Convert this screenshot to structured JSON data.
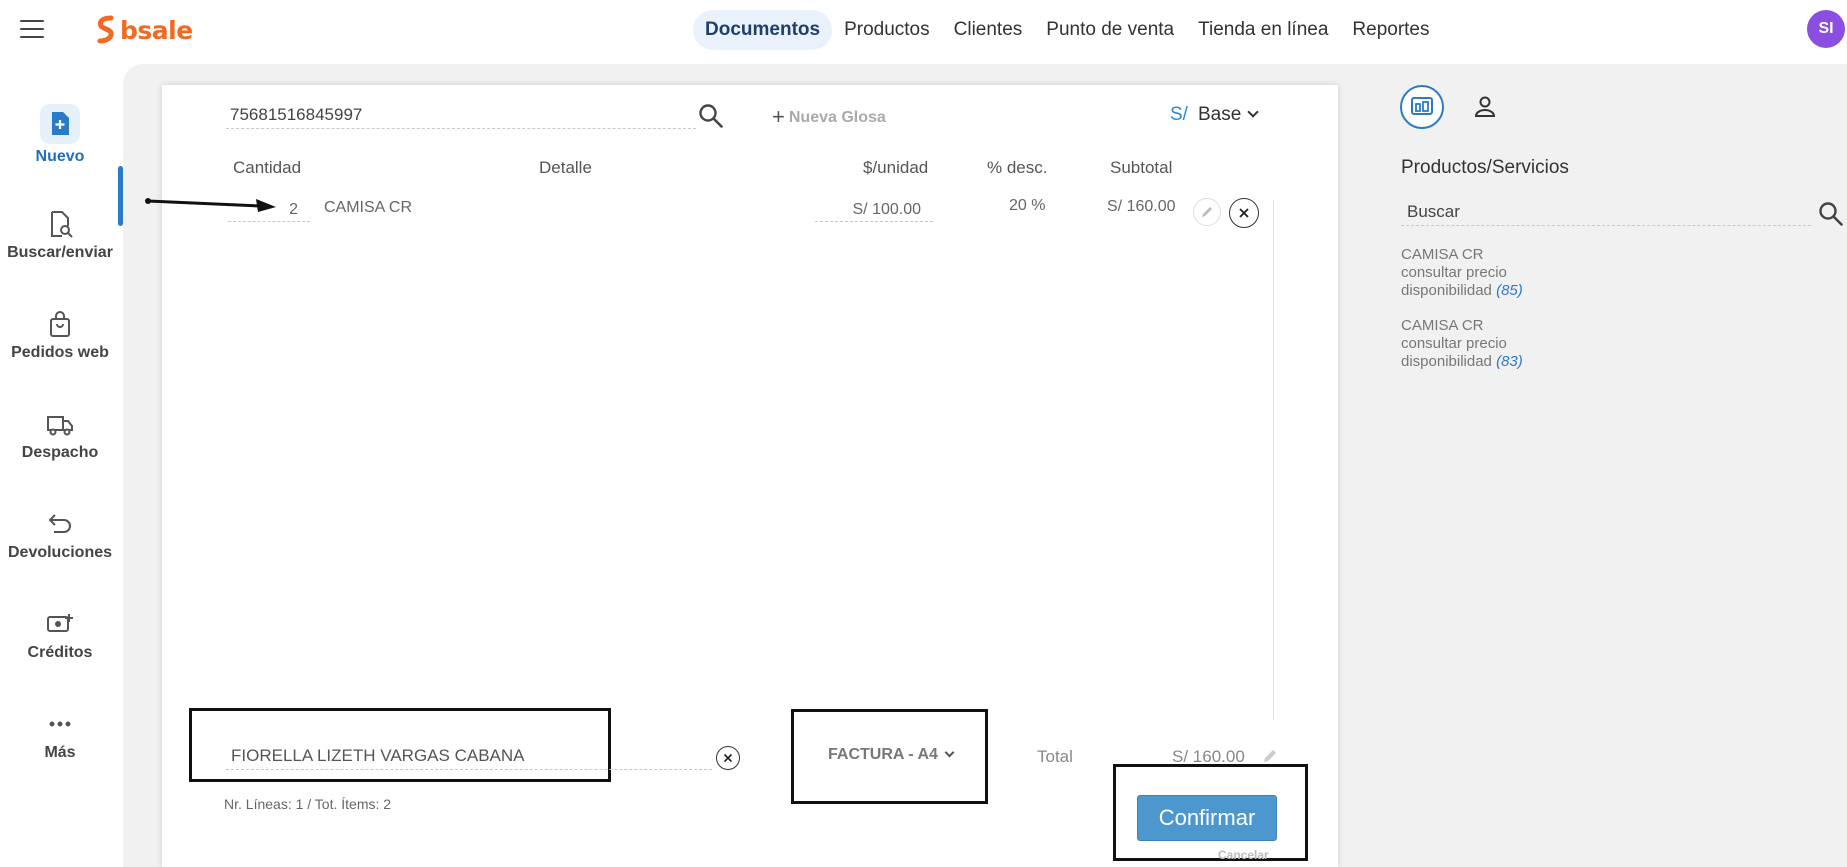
{
  "header": {
    "logo_text": "bsale",
    "nav": [
      {
        "label": "Documentos",
        "active": true
      },
      {
        "label": "Productos"
      },
      {
        "label": "Clientes"
      },
      {
        "label": "Punto de venta"
      },
      {
        "label": "Tienda en línea"
      },
      {
        "label": "Reportes"
      }
    ],
    "avatar_initials": "SI"
  },
  "sidebar": {
    "items": [
      {
        "label": "Nuevo",
        "icon": "document-plus-icon",
        "active": true
      },
      {
        "label": "Buscar/enviar",
        "icon": "document-search-icon"
      },
      {
        "label": "Pedidos web",
        "icon": "shopping-bag-icon"
      },
      {
        "label": "Despacho",
        "icon": "truck-icon"
      },
      {
        "label": "Devoluciones",
        "icon": "return-arrow-icon"
      },
      {
        "label": "Créditos",
        "icon": "money-plus-icon"
      },
      {
        "label": "Más",
        "icon": "more-dots-icon"
      }
    ]
  },
  "document": {
    "search_value": "75681516845997",
    "nueva_glosa": "Nueva Glosa",
    "currency_symbol": "S/",
    "price_list": "Base",
    "columns": {
      "qty": "Cantidad",
      "detail": "Detalle",
      "unit_price": "$/unidad",
      "discount": "% desc.",
      "subtotal": "Subtotal"
    },
    "rows": [
      {
        "qty": "2",
        "detail": "CAMISA CR",
        "unit_price": "S/ 100.00",
        "discount": "20 %",
        "subtotal": "S/ 160.00"
      }
    ],
    "client_name": "FIORELLA LIZETH VARGAS CABANA",
    "document_type": "FACTURA - A4",
    "total_label": "Total",
    "total_value": "S/ 160.00",
    "stats": "Nr. Líneas: 1 / Tot. Ítems: 2",
    "confirm_label": "Confirmar",
    "cancel_label": "Cancelar"
  },
  "right_panel": {
    "title": "Productos/Servicios",
    "search_placeholder": "Buscar",
    "products": [
      {
        "name": "CAMISA CR",
        "price": "consultar precio",
        "availability_label": "disponibilidad",
        "stock": "(85)"
      },
      {
        "name": "CAMISA CR",
        "price": "consultar precio",
        "availability_label": "disponibilidad",
        "stock": "(83)"
      }
    ]
  },
  "colors": {
    "brand": "#f26a21",
    "accent": "#2a7ac8",
    "confirm": "#4d97cf",
    "avatar": "#8a4ee0"
  }
}
